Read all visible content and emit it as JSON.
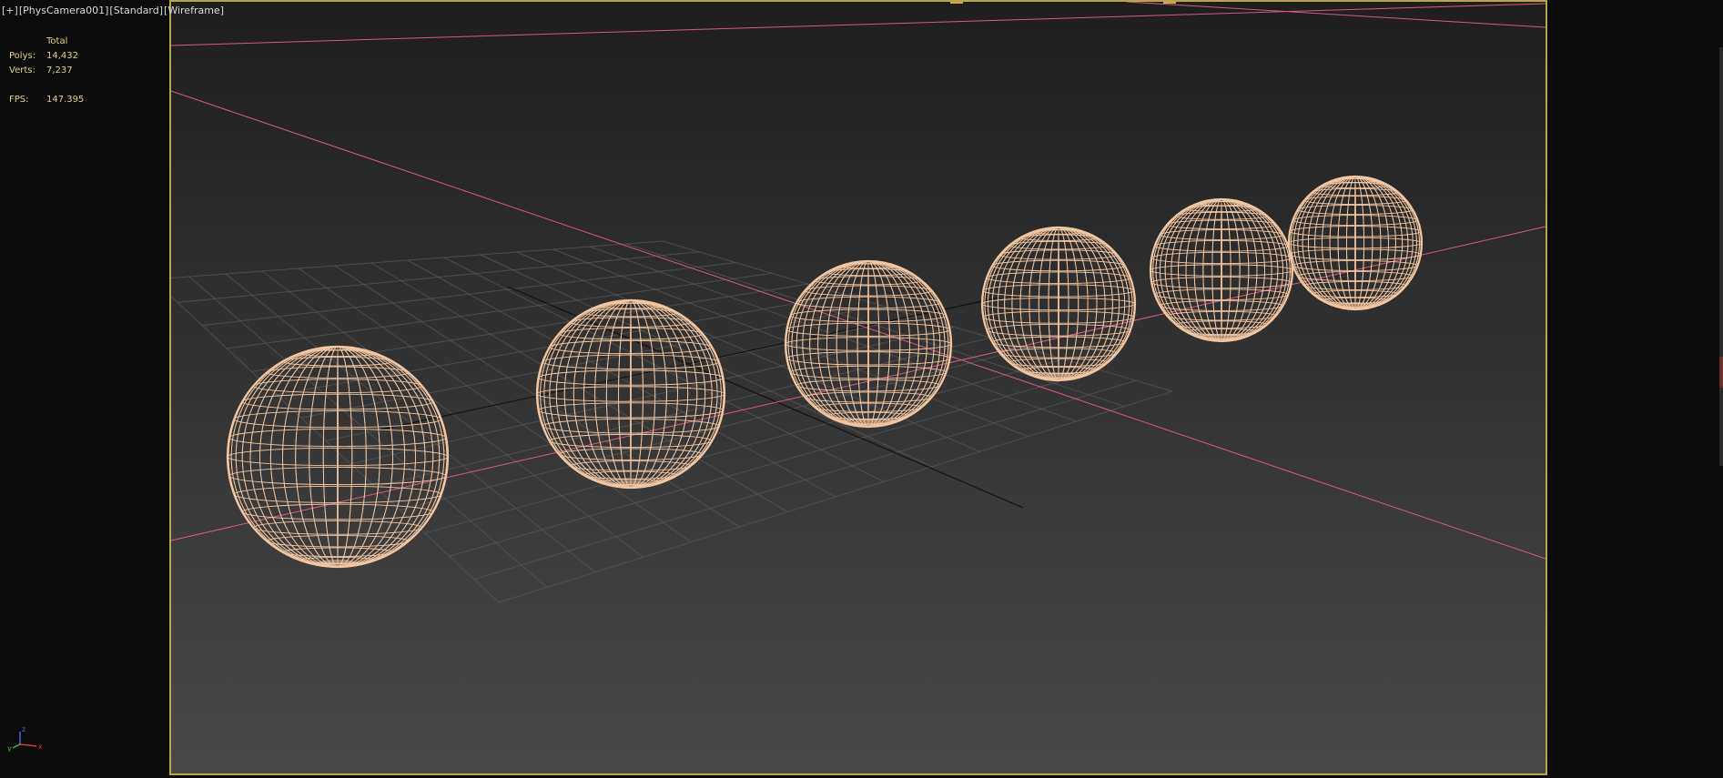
{
  "viewport": {
    "labels": [
      "[+]",
      "[PhysCamera001]",
      "[Standard]",
      "[Wireframe]"
    ]
  },
  "stats": {
    "total_label": "Total",
    "polys_label": "Polys:",
    "polys_value": "14,432",
    "verts_label": "Verts:",
    "verts_value": "7,237",
    "fps_label": "FPS:",
    "fps_value": "147.395"
  },
  "gizmo": {
    "x_label": "x",
    "y_label": "y",
    "z_label": "z"
  },
  "colors": {
    "frame_border": "#b6a54c",
    "wireframe": "#f2c6a2",
    "axis_line": "#d65a86",
    "grid_line": "#5a5a5a",
    "stats_text": "#e8cf8a"
  },
  "scene": {
    "object_count": 6,
    "object_type": "sphere-wireframe"
  }
}
